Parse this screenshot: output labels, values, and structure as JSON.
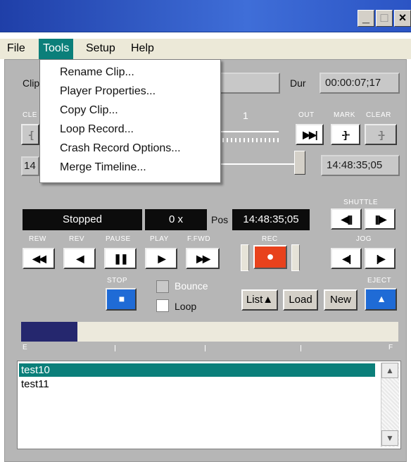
{
  "window": {
    "minimize_glyph": "_",
    "maximize_glyph": "□",
    "close_glyph": "×"
  },
  "menubar": {
    "file": "File",
    "tools": "Tools",
    "setup": "Setup",
    "help": "Help"
  },
  "tools_menu": [
    "Rename Clip...",
    "Player Properties...",
    "Copy Clip...",
    "Loop Record...",
    "Crash Record Options...",
    "Merge Timeline..."
  ],
  "clip": {
    "label": "Clip",
    "dur_label": "Dur",
    "dur_value": "00:00:07;17"
  },
  "marks": {
    "clear_label": "CLE",
    "in_field": "14",
    "speed_value": "1",
    "out_label": "OUT",
    "mark_label": "MARK",
    "clear2_label": "CLEAR",
    "out_time": "14:48:35;05"
  },
  "status": {
    "state": "Stopped",
    "speed": "0 x",
    "pos_label": "Pos",
    "pos_value": "14:48:35;05"
  },
  "transport": {
    "rew": "REW",
    "rev": "REV",
    "pause": "PAUSE",
    "play": "PLAY",
    "ffwd": "F.FWD",
    "rec": "REC",
    "stop": "STOP",
    "shuttle": "SHUTTLE",
    "jog": "JOG",
    "eject": "EJECT"
  },
  "options": {
    "bounce": "Bounce",
    "loop": "Loop"
  },
  "buttons": {
    "list": "List▲",
    "load": "Load",
    "new": "New"
  },
  "timeline": {
    "start": "E",
    "end": "F",
    "progress": 0.15
  },
  "clips": [
    "test10",
    "test11"
  ],
  "colors": {
    "accent_teal": "#0b7f7a",
    "rec_red": "#e8421c",
    "timeline_navy": "#25276e",
    "stop_blue": "#1f6bd6"
  }
}
